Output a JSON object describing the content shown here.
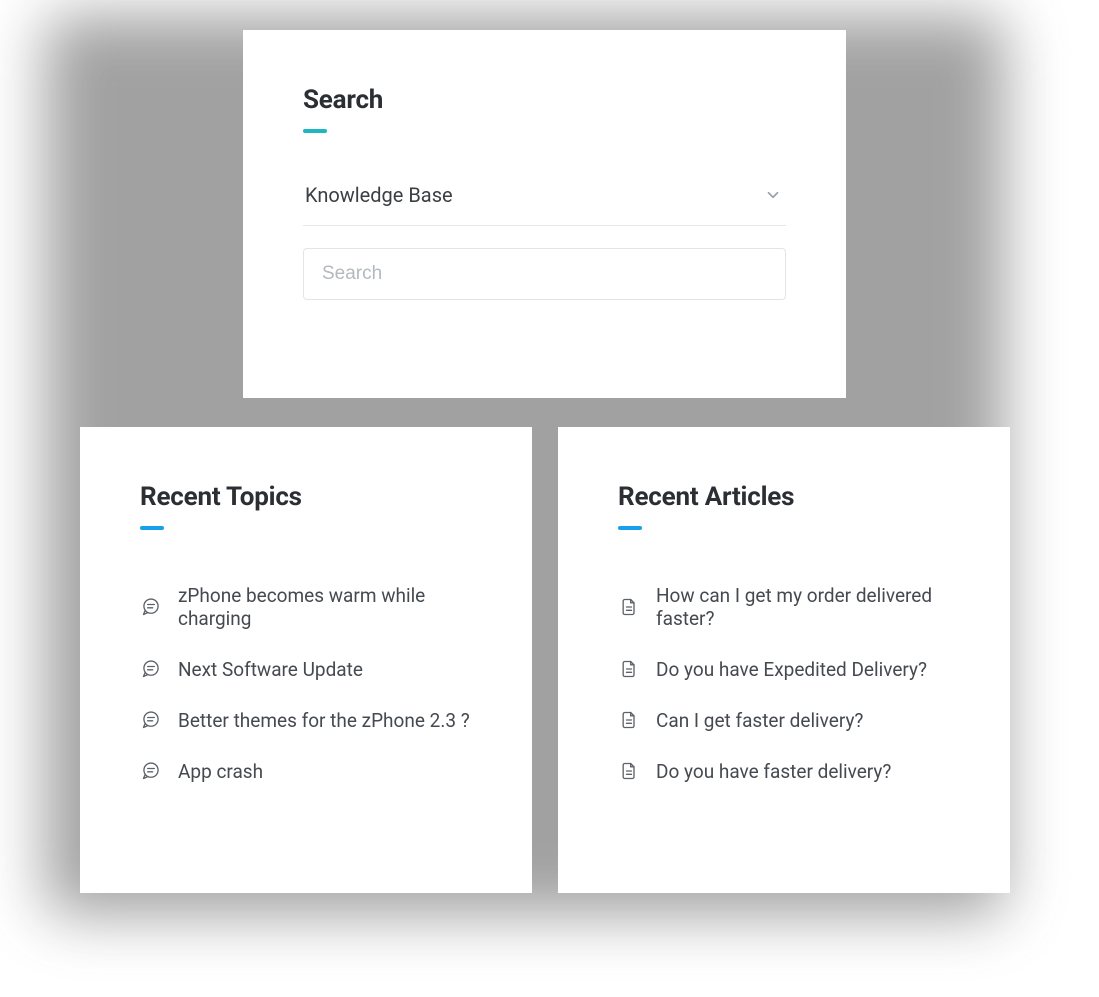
{
  "search": {
    "heading": "Search",
    "dropdown_label": "Knowledge Base",
    "placeholder": "Search"
  },
  "topics": {
    "heading": "Recent Topics",
    "items": [
      "zPhone becomes warm while charging",
      "Next Software Update",
      "Better themes for the zPhone 2.3 ?",
      "App crash"
    ]
  },
  "articles": {
    "heading": "Recent Articles",
    "items": [
      "How can I get my order delivered faster?",
      "Do you have Expedited Delivery?",
      "Can I get faster delivery?",
      "Do you have faster delivery?"
    ]
  }
}
